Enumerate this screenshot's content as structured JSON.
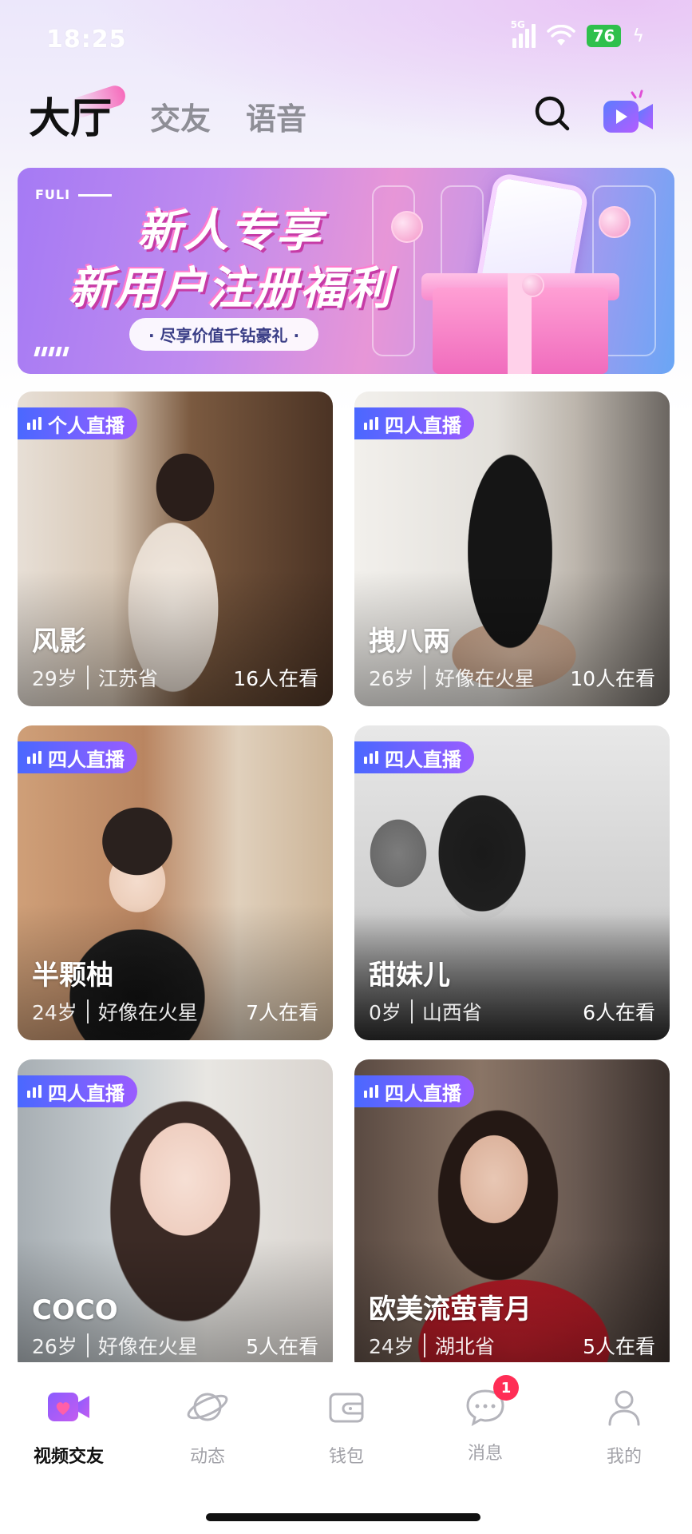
{
  "status_bar": {
    "time": "18:25",
    "network": "5G",
    "battery": "76"
  },
  "header": {
    "tabs": [
      {
        "label": "大厅",
        "active": true
      },
      {
        "label": "交友",
        "active": false
      },
      {
        "label": "语音",
        "active": false
      }
    ],
    "search_icon": "search-icon",
    "live_icon": "video-live-icon"
  },
  "banner": {
    "tag": "FULI",
    "title_line1": "新人专享",
    "title_line2": "新用户注册福利",
    "subtitle": "· 尽享价值千钻豪礼 ·"
  },
  "cards": [
    {
      "badge": "个人直播",
      "name": "风影",
      "age": "29岁",
      "location": "江苏省",
      "viewers": "16人在看"
    },
    {
      "badge": "四人直播",
      "name": "拽八两",
      "age": "26岁",
      "location": "好像在火星",
      "viewers": "10人在看"
    },
    {
      "badge": "四人直播",
      "name": "半颗柚",
      "age": "24岁",
      "location": "好像在火星",
      "viewers": "7人在看"
    },
    {
      "badge": "四人直播",
      "name": "甜妹儿",
      "age": "0岁",
      "location": "山西省",
      "viewers": "6人在看"
    },
    {
      "badge": "四人直播",
      "name": "COCO",
      "age": "26岁",
      "location": "好像在火星",
      "viewers": "5人在看"
    },
    {
      "badge": "四人直播",
      "name": "欧美流萤青月",
      "age": "24岁",
      "location": "湖北省",
      "viewers": "5人在看"
    }
  ],
  "bottom_nav": [
    {
      "label": "视频交友",
      "icon": "video-heart-icon",
      "active": true
    },
    {
      "label": "动态",
      "icon": "planet-icon",
      "active": false
    },
    {
      "label": "钱包",
      "icon": "wallet-icon",
      "active": false
    },
    {
      "label": "消息",
      "icon": "chat-icon",
      "active": false,
      "badge": "1"
    },
    {
      "label": "我的",
      "icon": "profile-icon",
      "active": false
    }
  ],
  "colors": {
    "accent": "#7b5cff",
    "badge_gradient_start": "#4a68ff",
    "badge_gradient_end": "#9a5cff",
    "unread": "#ff2d55"
  }
}
